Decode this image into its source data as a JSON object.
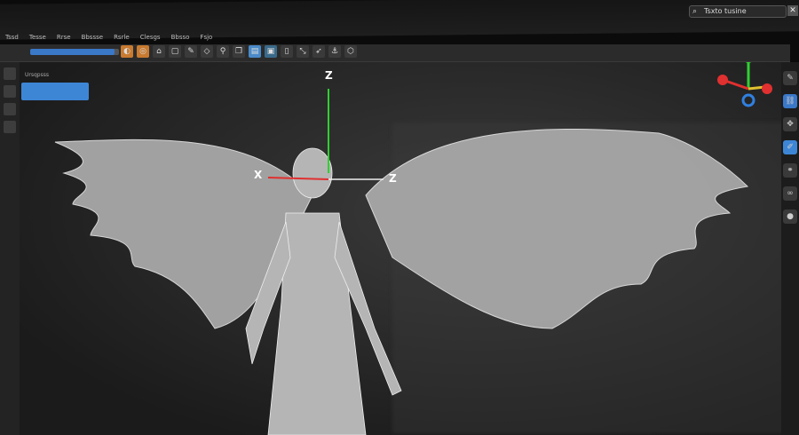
{
  "search": {
    "value": "Tsxto tusine",
    "icon": "search-icon"
  },
  "close_label": "✕",
  "menu": [
    "Tssd",
    "Tesse",
    "Rrse",
    "Bbssse",
    "Rsrle",
    "Clesgs",
    "Bbsso",
    "Fsjo"
  ],
  "outliner": {
    "header": "Ursqpsss"
  },
  "axes": {
    "z_up": "Z",
    "x": "X",
    "z_side": "Z"
  },
  "colors": {
    "accent": "#3d86d6",
    "x_axis": "#e03030",
    "y_axis": "#30d030",
    "z_axis": "#3080e0"
  }
}
